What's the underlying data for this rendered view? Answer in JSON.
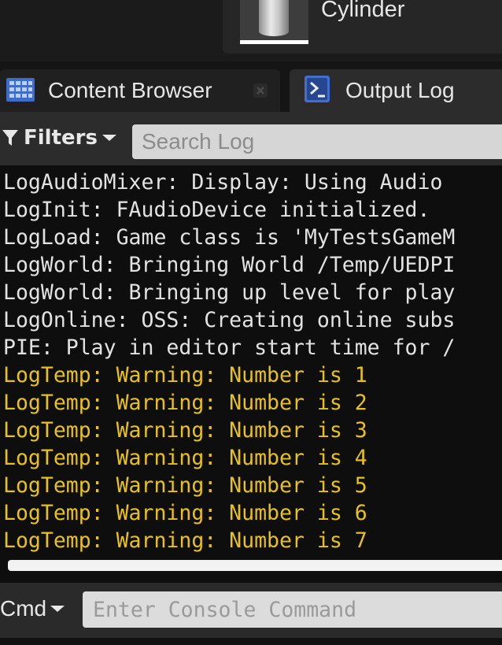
{
  "asset": {
    "name": "Cylinder",
    "thumbnail_icon": "cylinder-thumbnail"
  },
  "tabs": [
    {
      "label": "Content Browser",
      "icon": "content-browser-icon",
      "active": false,
      "closable": true
    },
    {
      "label": "Output Log",
      "icon": "output-log-icon",
      "active": true
    }
  ],
  "filters": {
    "label": "Filters",
    "icon": "filter-icon"
  },
  "search": {
    "placeholder": "Search Log",
    "value": ""
  },
  "log": {
    "lines": [
      {
        "text": "LogAudioMixer: Display: Using Audio",
        "level": "display"
      },
      {
        "text": "LogInit: FAudioDevice initialized.",
        "level": "display"
      },
      {
        "text": "LogLoad: Game class is 'MyTestsGameM",
        "level": "display"
      },
      {
        "text": "LogWorld: Bringing World /Temp/UEDPI",
        "level": "display"
      },
      {
        "text": "LogWorld: Bringing up level for play",
        "level": "display"
      },
      {
        "text": "LogOnline: OSS: Creating online subs",
        "level": "display"
      },
      {
        "text": "PIE: Play in editor start time for /",
        "level": "display"
      },
      {
        "text": "LogTemp: Warning: Number is 1",
        "level": "warning"
      },
      {
        "text": "LogTemp: Warning: Number is 2",
        "level": "warning"
      },
      {
        "text": "LogTemp: Warning: Number is 3",
        "level": "warning"
      },
      {
        "text": "LogTemp: Warning: Number is 4",
        "level": "warning"
      },
      {
        "text": "LogTemp: Warning: Number is 5",
        "level": "warning"
      },
      {
        "text": "LogTemp: Warning: Number is 6",
        "level": "warning"
      },
      {
        "text": "LogTemp: Warning: Number is 7",
        "level": "warning"
      }
    ]
  },
  "console": {
    "label": "Cmd",
    "placeholder": "Enter Console Command",
    "value": ""
  },
  "colors": {
    "warning_text": "#e8c21c",
    "log_text": "#e2e2e2",
    "log_background": "#0e0e0e",
    "panel_background": "#2c2c2c",
    "tab_icon_blue": "#3f6fd0"
  }
}
